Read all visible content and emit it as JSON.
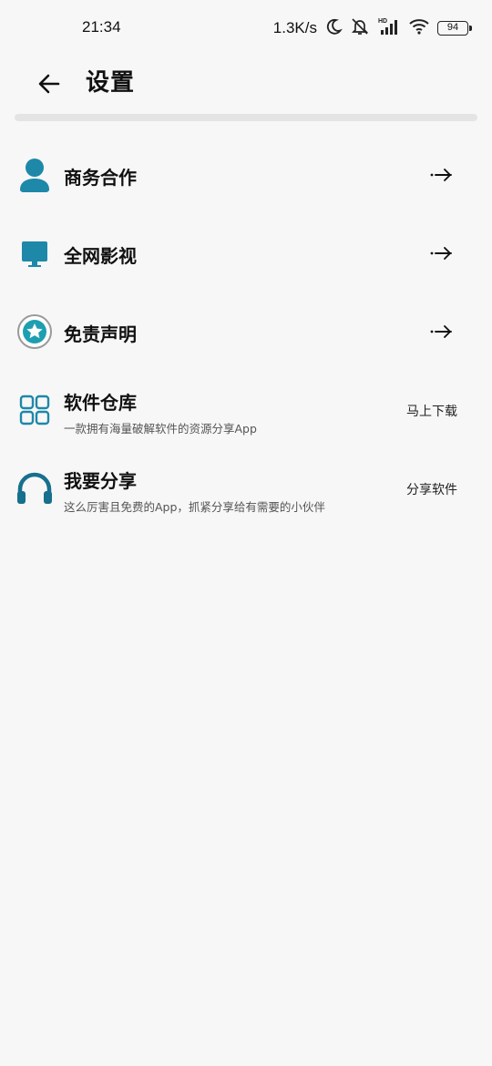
{
  "status_bar": {
    "time": "21:34",
    "net_speed": "1.3K/s",
    "battery": "94",
    "icons": [
      "moon-icon",
      "bell-muted-icon",
      "hd-signal-icon",
      "wifi-icon",
      "battery-icon"
    ]
  },
  "header": {
    "back_icon": "arrow-left-icon",
    "title": "设置"
  },
  "colors": {
    "accent": "#1e88a8",
    "accent_dark": "#17708d",
    "background": "#f7f7f7"
  },
  "menu": {
    "items": [
      {
        "title": "商务合作",
        "icon": "person-icon",
        "trailing": "arrow-right-icon"
      },
      {
        "title": "全网影视",
        "icon": "monitor-icon",
        "trailing": "arrow-right-icon"
      },
      {
        "title": "免责声明",
        "icon": "star-badge-icon",
        "trailing": "arrow-right-icon"
      },
      {
        "title": "软件仓库",
        "subtitle": "一款拥有海量破解软件的资源分享App",
        "icon": "grid-icon",
        "action": "马上下载"
      },
      {
        "title": "我要分享",
        "subtitle": "这么厉害且免费的App，抓紧分享给有需要的小伙伴",
        "icon": "headphones-icon",
        "action": "分享软件"
      }
    ]
  }
}
